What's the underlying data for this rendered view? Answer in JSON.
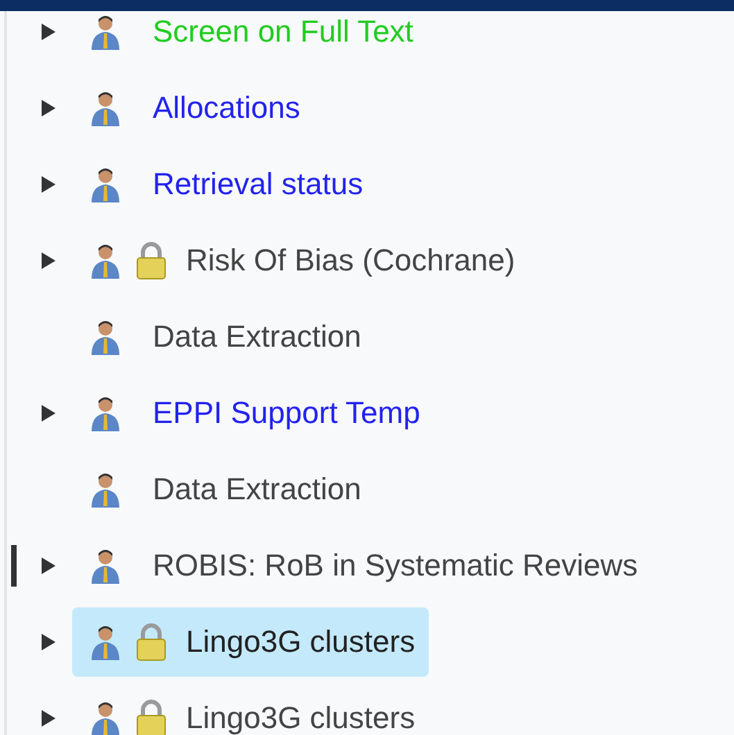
{
  "items": [
    {
      "label": "Screen on Full Text",
      "color": "#22cc22",
      "expandable": true,
      "locked": false,
      "selected": false,
      "focused": false
    },
    {
      "label": "Allocations",
      "color": "#2222ee",
      "expandable": true,
      "locked": false,
      "selected": false,
      "focused": false
    },
    {
      "label": "Retrieval status",
      "color": "#2222ee",
      "expandable": true,
      "locked": false,
      "selected": false,
      "focused": false
    },
    {
      "label": "Risk Of Bias (Cochrane)",
      "color": "#444444",
      "expandable": true,
      "locked": true,
      "selected": false,
      "focused": false
    },
    {
      "label": "Data Extraction",
      "color": "#444444",
      "expandable": false,
      "locked": false,
      "selected": false,
      "focused": false
    },
    {
      "label": "EPPI Support Temp",
      "color": "#2222ee",
      "expandable": true,
      "locked": false,
      "selected": false,
      "focused": false
    },
    {
      "label": "Data Extraction",
      "color": "#444444",
      "expandable": false,
      "locked": false,
      "selected": false,
      "focused": false
    },
    {
      "label": "ROBIS: RoB in Systematic Reviews",
      "color": "#444444",
      "expandable": true,
      "locked": false,
      "selected": false,
      "focused": true
    },
    {
      "label": "Lingo3G clusters",
      "color": "#222222",
      "expandable": true,
      "locked": true,
      "selected": true,
      "focused": false
    },
    {
      "label": "Lingo3G clusters",
      "color": "#444444",
      "expandable": true,
      "locked": true,
      "selected": false,
      "focused": false
    }
  ]
}
